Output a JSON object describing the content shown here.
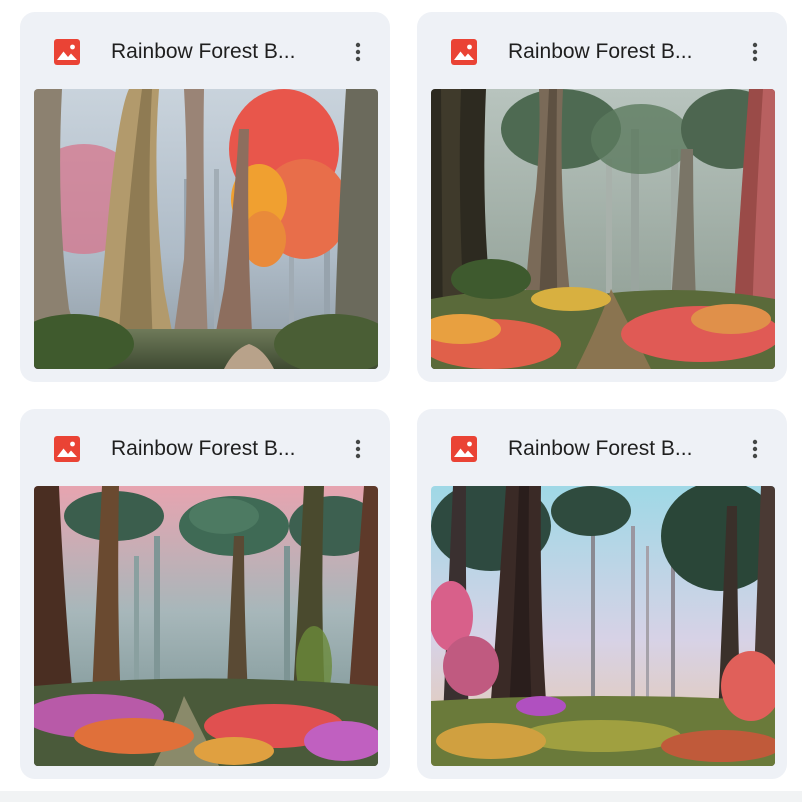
{
  "files": [
    {
      "name": "Rainbow Forest B...",
      "type_icon": "image-icon",
      "menu_icon": "more-vert-icon",
      "thumbnail": "Misty forest with tall eucalyptus trunks and red-orange foliage"
    },
    {
      "name": "Rainbow Forest B...",
      "type_icon": "image-icon",
      "menu_icon": "more-vert-icon",
      "thumbnail": "Forest path with giant redwood trunks and red flowers"
    },
    {
      "name": "Rainbow Forest B...",
      "type_icon": "image-icon",
      "menu_icon": "more-vert-icon",
      "thumbnail": "Pink misty forest with mushroom-shaped trees and colorful undergrowth"
    },
    {
      "name": "Rainbow Forest B...",
      "type_icon": "image-icon",
      "menu_icon": "more-vert-icon",
      "thumbnail": "Bright forest clearing with tall pines and pink blossoms"
    }
  ],
  "colors": {
    "card_bg": "#eef1f6",
    "image_icon": "#ea4335",
    "text": "#1f1f1f",
    "menu_dots": "#444746"
  }
}
